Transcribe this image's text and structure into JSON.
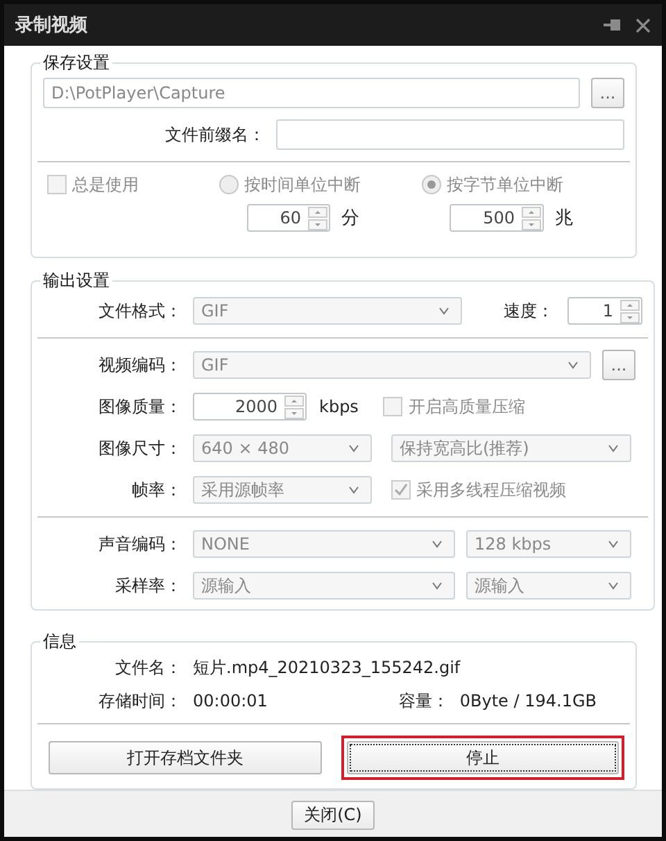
{
  "window": {
    "title": "录制视频"
  },
  "save": {
    "legend": "保存设置",
    "path": "D:\\PotPlayer\\Capture",
    "browse": "...",
    "prefix_label": "文件前缀名：",
    "always": {
      "label": "总是使用",
      "checked": false,
      "disabled": true
    },
    "split": [
      {
        "label": "按时间单位中断",
        "selected": false,
        "disabled": true,
        "value": "60",
        "unit": "分"
      },
      {
        "label": "按字节单位中断",
        "selected": true,
        "disabled": true,
        "value": "500",
        "unit": "兆"
      }
    ]
  },
  "output": {
    "legend": "输出设置",
    "format": {
      "label": "文件格式：",
      "value": "GIF"
    },
    "speed": {
      "label": "速度：",
      "value": "1"
    },
    "codec": {
      "label": "视频编码：",
      "value": "GIF",
      "browse": "..."
    },
    "quality": {
      "label": "图像质量：",
      "value": "2000",
      "unit": "kbps",
      "check": {
        "label": "开启高质量压缩",
        "checked": false,
        "disabled": true
      }
    },
    "size": {
      "label": "图像尺寸：",
      "value": "640 × 480",
      "aspect": "保持宽高比(推荐)"
    },
    "fps": {
      "label": "帧率：",
      "value": "采用源帧率",
      "check": {
        "label": "采用多线程压缩视频",
        "checked": true,
        "disabled": true
      }
    },
    "audio": {
      "label": "声音编码：",
      "value": "NONE",
      "bitrate": "128 kbps"
    },
    "sample": {
      "label": "采样率：",
      "value": "源输入",
      "value_2": "源输入"
    }
  },
  "info": {
    "legend": "信息",
    "filename": {
      "label": "文件名：",
      "value": "短片.mp4_20210323_155242.gif"
    },
    "time": {
      "label": "存储时间：",
      "value": "00:00:01"
    },
    "capacity": {
      "label": "容量：",
      "value": "0Byte / 194.1GB"
    },
    "buttons": [
      {
        "label": "打开存档文件夹",
        "highlighted": false
      },
      {
        "label": "停止",
        "highlighted": true
      }
    ]
  },
  "footer": {
    "close": "关闭(C)"
  }
}
